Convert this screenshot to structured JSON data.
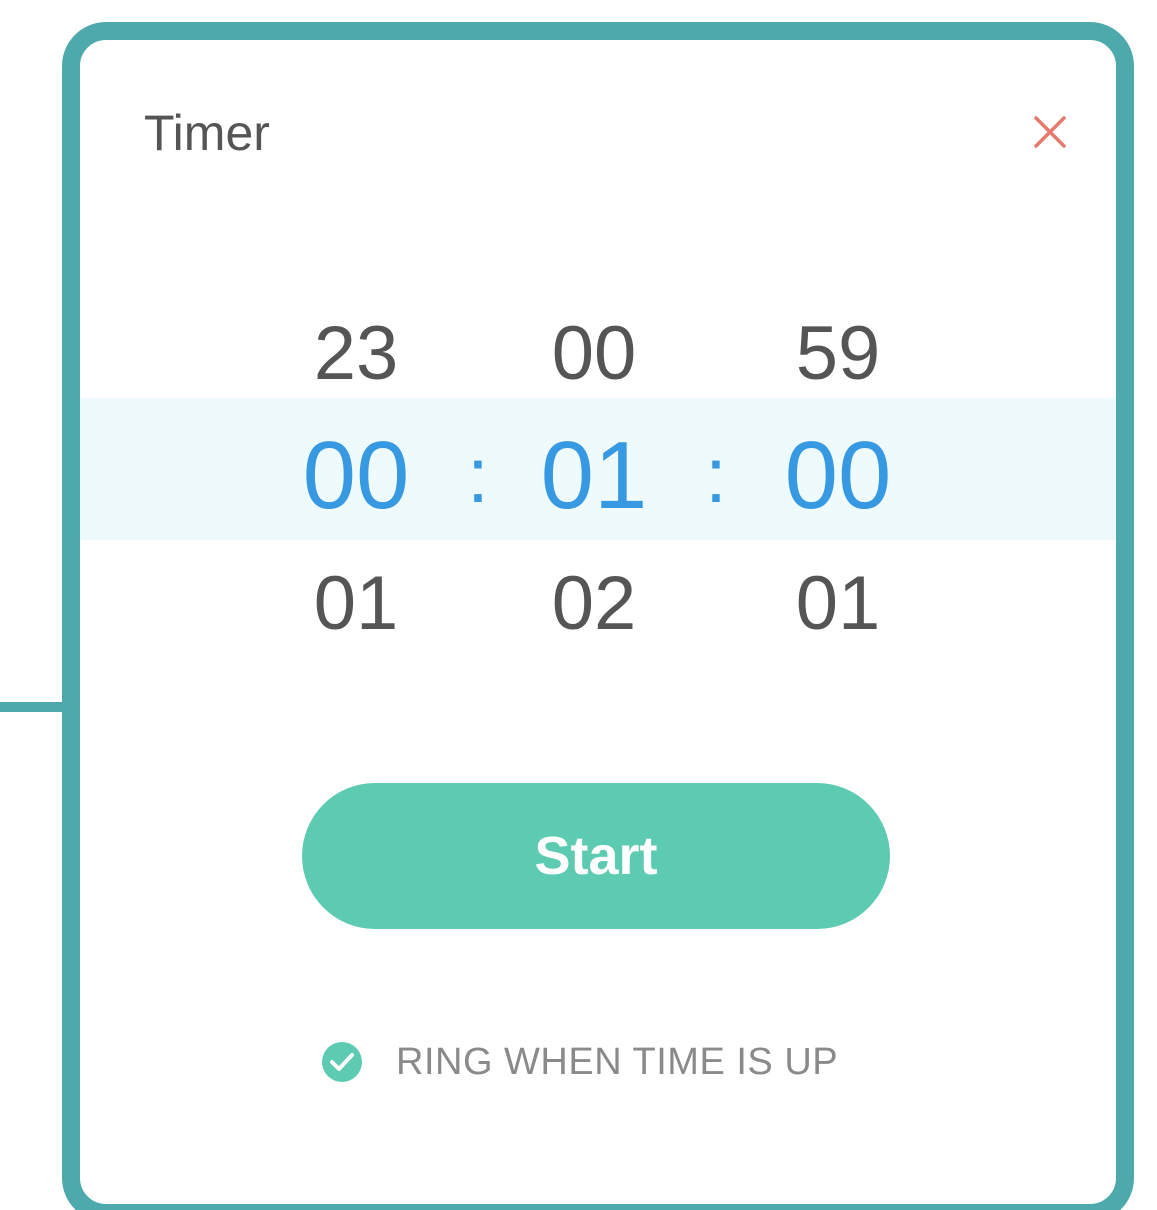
{
  "dialog": {
    "title": "Timer",
    "close_icon": "close-icon"
  },
  "picker": {
    "hours": {
      "above": "23",
      "selected": "00",
      "below": "01"
    },
    "minutes": {
      "above": "00",
      "selected": "01",
      "below": "02"
    },
    "seconds": {
      "above": "59",
      "selected": "00",
      "below": "01"
    },
    "separator": ":"
  },
  "start_button": {
    "label": "Start"
  },
  "ring_option": {
    "label": "RING WHEN TIME IS UP",
    "checked": true,
    "icon": "check-circle-icon"
  },
  "colors": {
    "frame": "#4ea9ad",
    "accent": "#5ccbb1",
    "selected_digits": "#3699e1",
    "close": "#e8796c",
    "highlight_band": "#eefafc"
  }
}
